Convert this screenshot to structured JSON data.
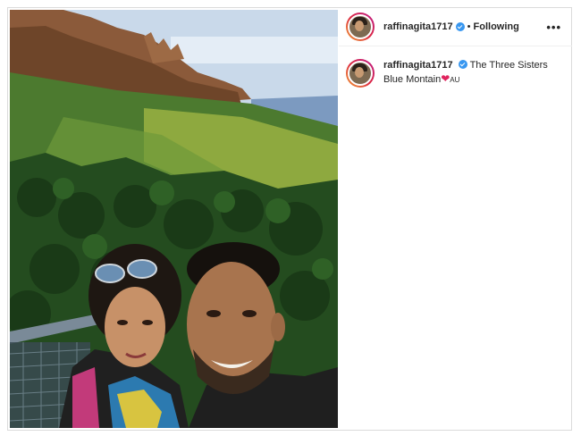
{
  "post": {
    "username": "raffinagita1717",
    "separator": "•",
    "follow_label": "Following",
    "more_label": "•••",
    "caption_text": "The Three Sisters Blue Montain",
    "caption_heart": "❤",
    "caption_country": "AU"
  },
  "photo": {
    "description_icon": "photo",
    "colors": {
      "sky": "#c6d6e8",
      "cliff": "#8a5a3a",
      "forest_far": "#4f7a32",
      "forest_near": "#234a1e",
      "highlight": "#a6b84a"
    }
  }
}
